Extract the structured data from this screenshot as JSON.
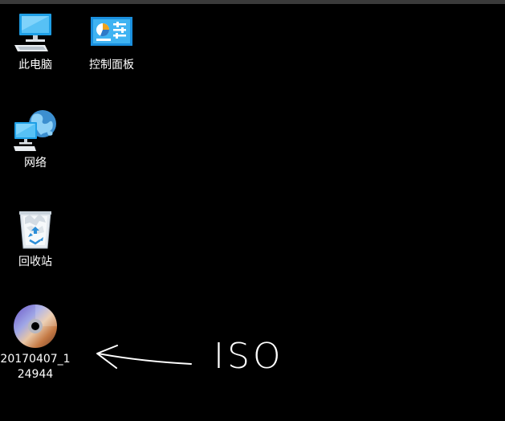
{
  "desktop": {
    "background_color": "#000000",
    "icons": [
      {
        "label": "此电脑",
        "icon": "this-pc-icon"
      },
      {
        "label": "控制面板",
        "icon": "control-panel-icon"
      },
      {
        "label": "网络",
        "icon": "network-icon"
      },
      {
        "label": "回收站",
        "icon": "recycle-bin-icon"
      },
      {
        "label": "20170407_124944",
        "icon": "disc-image-icon"
      }
    ]
  },
  "annotation": {
    "text": "ISO",
    "color": "#ffffff",
    "arrow": "left-arrow"
  }
}
